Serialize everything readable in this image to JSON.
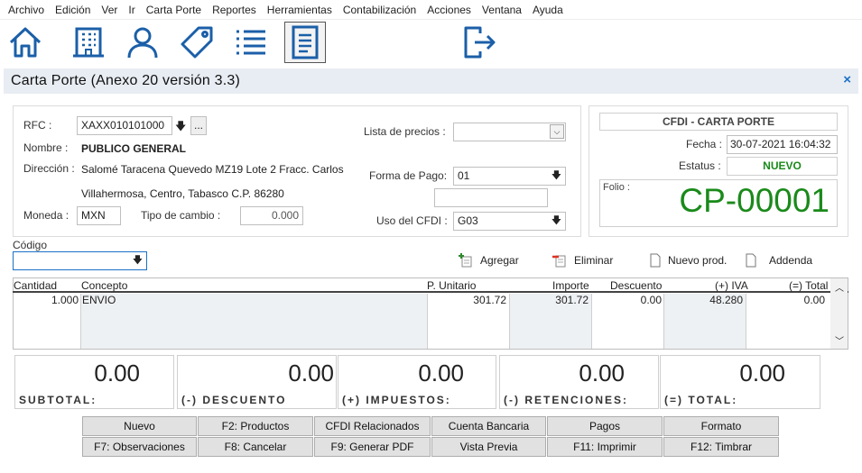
{
  "menu": [
    "Archivo",
    "Edición",
    "Ver",
    "Ir",
    "Carta Porte",
    "Reportes",
    "Herramientas",
    "Contabilización",
    "Acciones",
    "Ventana",
    "Ayuda"
  ],
  "toolbar": {
    "icons": [
      "home-icon",
      "building-icon",
      "user-icon",
      "tag-icon",
      "list-icon",
      "document-icon",
      "exit-icon"
    ],
    "active": "document-icon"
  },
  "window": {
    "title": "Carta Porte (Anexo 20 versión 3.3)",
    "close": "×"
  },
  "client": {
    "rfc_label": "RFC :",
    "rfc_value": "XAXX010101000",
    "browse": "...",
    "nombre_label": "Nombre :",
    "nombre_value": "PUBLICO GENERAL",
    "direccion_label": "Dirección :",
    "direccion_line1": "Salomé Taracena Quevedo MZ19 Lote 2 Fracc. Carlos",
    "direccion_line2": "Villahermosa, Centro, Tabasco C.P. 86280",
    "moneda_label": "Moneda :",
    "moneda_value": "MXN",
    "tipo_cambio_label": "Tipo de cambio :",
    "tipo_cambio_value": "0.000"
  },
  "payment": {
    "lista_label": "Lista de precios :",
    "lista_value": "",
    "forma_label": "Forma de Pago:",
    "forma_value": "01",
    "extra_value": "",
    "uso_label": "Uso del CFDI :",
    "uso_value": "G03"
  },
  "cfdi": {
    "header": "CFDI - CARTA PORTE",
    "fecha_label": "Fecha :",
    "fecha_value": "30-07-2021 16:04:32",
    "estatus_label": "Estatus :",
    "estatus_value": "NUEVO",
    "folio_label": "Folio :",
    "folio_value": "CP-00001",
    "status_color": "#1a8a1a"
  },
  "codigo": {
    "label": "Código",
    "value": ""
  },
  "actions": {
    "agregar": "Agregar",
    "eliminar": "Eliminar",
    "nuevo_prod": "Nuevo prod.",
    "addenda": "Addenda"
  },
  "grid": {
    "columns": [
      "Cantidad",
      "Concepto",
      "P. Unitario",
      "Importe",
      "Descuento",
      "(+) IVA",
      "(=) Total"
    ],
    "rows": [
      {
        "cantidad": "1.000",
        "concepto": "ENVIO",
        "punitario": "301.72",
        "importe": "301.72",
        "descuento": "0.00",
        "iva": "48.280",
        "total": "0.00"
      }
    ]
  },
  "totals": [
    {
      "caption": "SUBTOTAL:",
      "value": "0.00"
    },
    {
      "caption": "(-) DESCUENTO",
      "value": "0.00"
    },
    {
      "caption": "(+) IMPUESTOS:",
      "value": "0.00"
    },
    {
      "caption": "(-) RETENCIONES:",
      "value": "0.00"
    },
    {
      "caption": "(=) TOTAL:",
      "value": "0.00"
    }
  ],
  "buttons": {
    "row1": [
      "Nuevo",
      "F2: Productos",
      "CFDI Relacionados",
      "Cuenta Bancaria",
      "Pagos",
      "Formato"
    ],
    "row2": [
      "F7: Observaciones",
      "F8: Cancelar",
      "F9: Generar PDF",
      "Vista Previa",
      "F11: Imprimir",
      "F12:  Timbrar"
    ]
  },
  "colors": {
    "accent": "#1b6fc7",
    "title_bg": "#e8edf3",
    "folio": "#1a8a1a"
  }
}
